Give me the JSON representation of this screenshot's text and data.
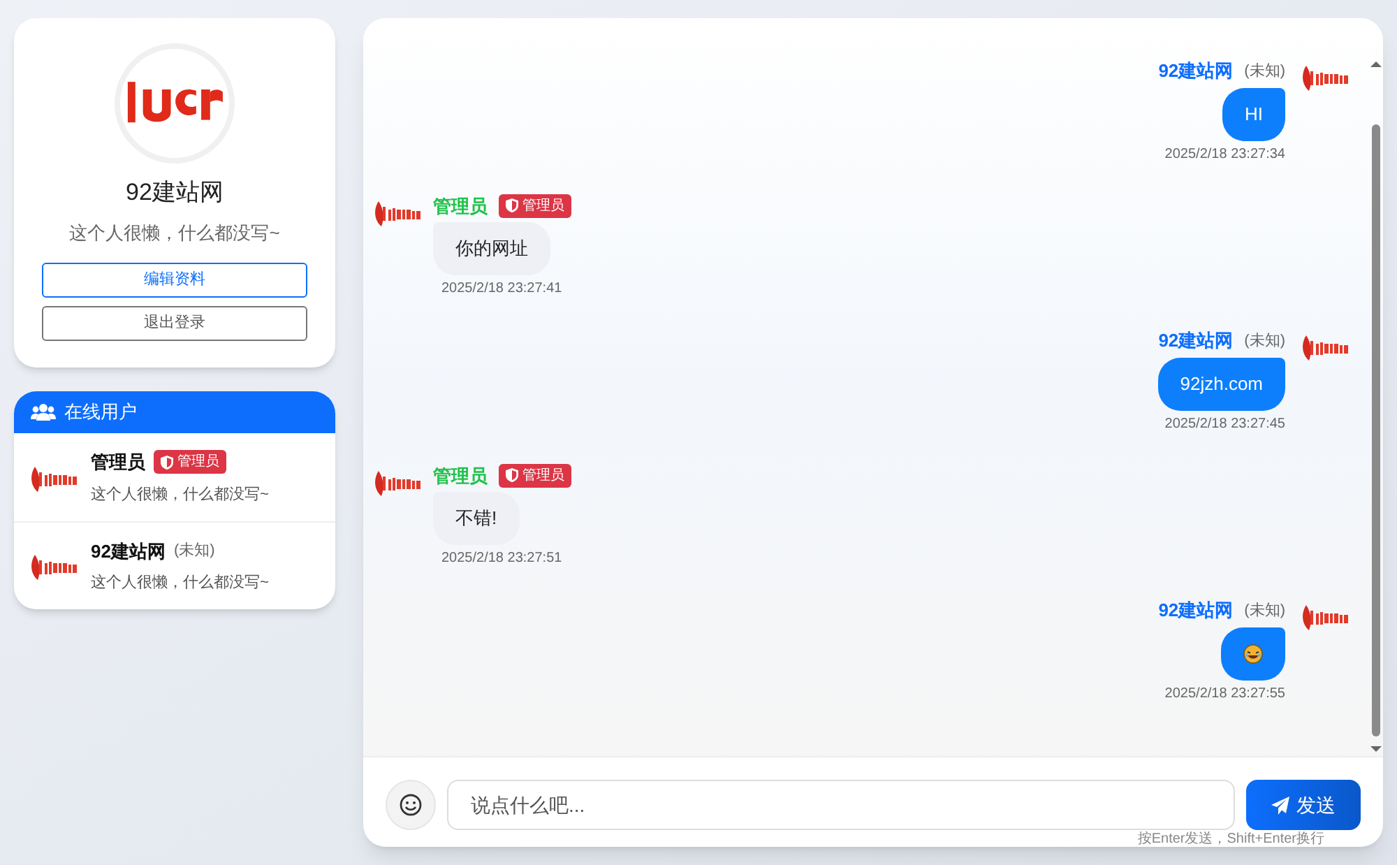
{
  "profile": {
    "name": "92建站网",
    "bio": "这个人很懒，什么都没写~",
    "buttons": [
      {
        "label": "编辑资料",
        "kind": "primary"
      },
      {
        "label": "退出登录",
        "kind": "secondary"
      }
    ]
  },
  "online_users": {
    "title": "在线用户",
    "users": [
      {
        "name": "管理员",
        "badge": {
          "kind": "admin",
          "text": "管理员"
        },
        "bio": "这个人很懒，什么都没写~"
      },
      {
        "name": "92建站网",
        "badge": {
          "kind": "note",
          "text": "(未知)"
        },
        "bio": "这个人很懒，什么都没写~"
      }
    ]
  },
  "messages": [
    {
      "own": true,
      "sender": "92建站网",
      "badge": {
        "kind": "note",
        "text": "(未知)"
      },
      "kind": "text",
      "text": "HI",
      "time": "2025/2/18 23:27:34"
    },
    {
      "own": false,
      "sender": "管理员",
      "badge": {
        "kind": "admin",
        "text": "管理员"
      },
      "kind": "text",
      "text": "你的网址",
      "time": "2025/2/18 23:27:41"
    },
    {
      "own": true,
      "sender": "92建站网",
      "badge": {
        "kind": "note",
        "text": "(未知)"
      },
      "kind": "text",
      "text": "92jzh.com",
      "time": "2025/2/18 23:27:45"
    },
    {
      "own": false,
      "sender": "管理员",
      "badge": {
        "kind": "admin",
        "text": "管理员"
      },
      "kind": "text",
      "text": "不错!",
      "time": "2025/2/18 23:27:51"
    },
    {
      "own": true,
      "sender": "92建站网",
      "badge": {
        "kind": "note",
        "text": "(未知)"
      },
      "kind": "emoji",
      "time": "2025/2/18 23:27:55"
    }
  ],
  "composer": {
    "placeholder": "说点什么吧...",
    "send": "发送",
    "hint": "按Enter发送，Shift+Enter换行"
  }
}
